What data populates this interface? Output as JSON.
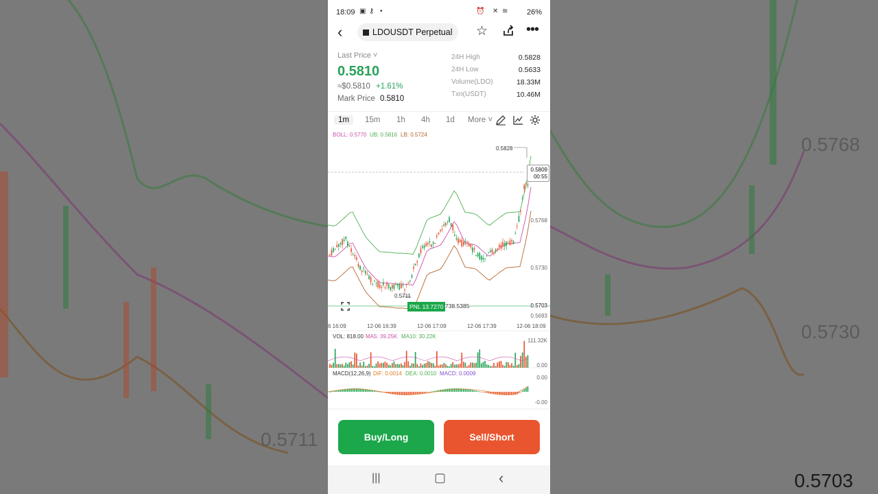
{
  "status_bar": {
    "time": "18:09",
    "battery": "26%"
  },
  "header": {
    "pair": "LDOUSDT Perpetual"
  },
  "ticker": {
    "last_price_label": "Last Price",
    "last_price": "0.5810",
    "approx": "≈$0.5810",
    "change": "+1.61%",
    "mark_label": "Mark Price",
    "mark_value": "0.5810",
    "stats": [
      {
        "label": "24H High",
        "value": "0.5828"
      },
      {
        "label": "24H Low",
        "value": "0.5633"
      },
      {
        "label": "Volume(LDO)",
        "value": "18.33M"
      },
      {
        "label": "Txn(USDT)",
        "value": "10.46M"
      }
    ]
  },
  "timeframes": [
    "1m",
    "15m",
    "1h",
    "4h",
    "1d",
    "More"
  ],
  "active_timeframe": "1m",
  "chart": {
    "boll": "BOLL: 0.5770",
    "ub": "UB: 0.5816",
    "lb": "LB: 0.5724",
    "high_marker": "0.5828",
    "current_price": "0.5809",
    "countdown": "00:55",
    "low_marker": "0.5711",
    "pnl": "PNL 13.7270",
    "position_price": "738.5385",
    "y_labels": [
      "0.5768",
      "0.5730",
      "0.5703",
      "0.5693"
    ],
    "x_labels": [
      "6 16:09",
      "12-06 16:39",
      "12-06 17:09",
      "12-06 17:39",
      "12-06 18:09"
    ],
    "vol": "VOL: 818.00",
    "ma5": "MA5: 39.25K",
    "ma10": "MA10: 30.22K",
    "vol_max": "111.32K",
    "vol_min": "0.00",
    "macd_label": "MACD(12,26,9)",
    "dif": "DIF: 0.0014",
    "dea": "DEA: 0.0010",
    "macd": "MACD: 0.0009",
    "macd_top": "0.00",
    "macd_bottom": "-0.00",
    "colors": {
      "up": "#26a65b",
      "down": "#e8542f",
      "boll": "#c94fa8",
      "ub": "#4caf50",
      "lb": "#b5652c"
    }
  },
  "background": {
    "left_label": "0.5711",
    "right_labels": [
      "0.5768",
      "0.5730",
      "0.5703"
    ]
  },
  "actions": {
    "buy": "Buy/Long",
    "sell": "Sell/Short",
    "buy_color": "#1ba74a",
    "sell_color": "#e9552e"
  }
}
